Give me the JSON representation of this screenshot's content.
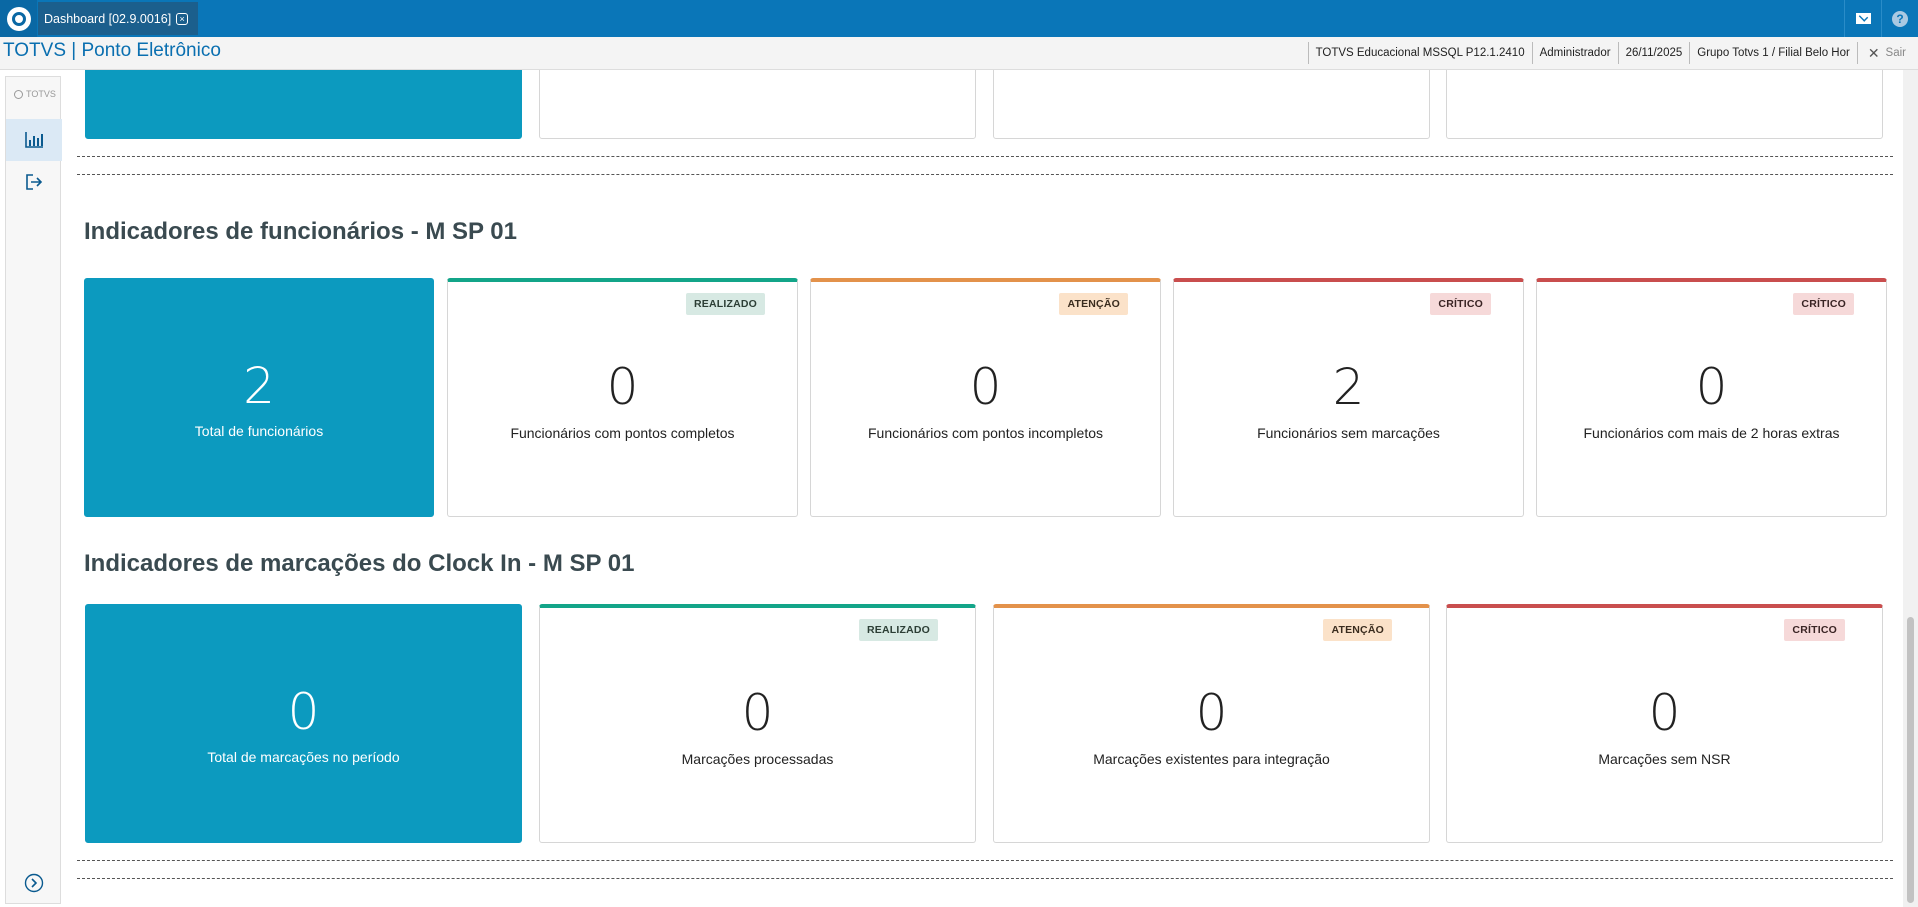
{
  "topbar": {
    "tab_label": "Dashboard [02.9.0016]",
    "tab_close": "×"
  },
  "header": {
    "app_title": "TOTVS | Ponto Eletrônico",
    "environment": "TOTVS Educacional MSSQL P12.1.2410",
    "user": "Administrador",
    "date": "26/11/2025",
    "branch": "Grupo Totvs 1 / Filial Belo Hor",
    "logout_label": "Sair"
  },
  "sidebar": {
    "brand": "TOTVS",
    "items": [
      {
        "icon": "bar-chart-icon",
        "active": true
      },
      {
        "icon": "logout-icon",
        "active": false
      }
    ]
  },
  "sections": {
    "employees": {
      "title": "Indicadores de funcionários - M SP 01",
      "cards": [
        {
          "value": "2",
          "label": "Total de funcionários"
        },
        {
          "value": "0",
          "label": "Funcionários com pontos completos",
          "badge": "REALIZADO"
        },
        {
          "value": "0",
          "label": "Funcionários com pontos incompletos",
          "badge": "ATENÇÃO"
        },
        {
          "value": "2",
          "label": "Funcionários sem marcações",
          "badge": "CRÍTICO"
        },
        {
          "value": "0",
          "label": "Funcionários com mais de 2 horas extras",
          "badge": "CRÍTICO"
        }
      ]
    },
    "clockin": {
      "title": "Indicadores de marcações do Clock In - M SP 01",
      "cards": [
        {
          "value": "0",
          "label": "Total de marcações no período"
        },
        {
          "value": "0",
          "label": "Marcações processadas",
          "badge": "REALIZADO"
        },
        {
          "value": "0",
          "label": "Marcações existentes para integração",
          "badge": "ATENÇÃO"
        },
        {
          "value": "0",
          "label": "Marcações sem NSR",
          "badge": "CRÍTICO"
        }
      ]
    }
  },
  "colors": {
    "topbar": "#0a76b8",
    "card_blue": "#0c9abf",
    "status_done": "#13a589",
    "status_warning": "#e3924b",
    "status_critical": "#c94e4e"
  }
}
